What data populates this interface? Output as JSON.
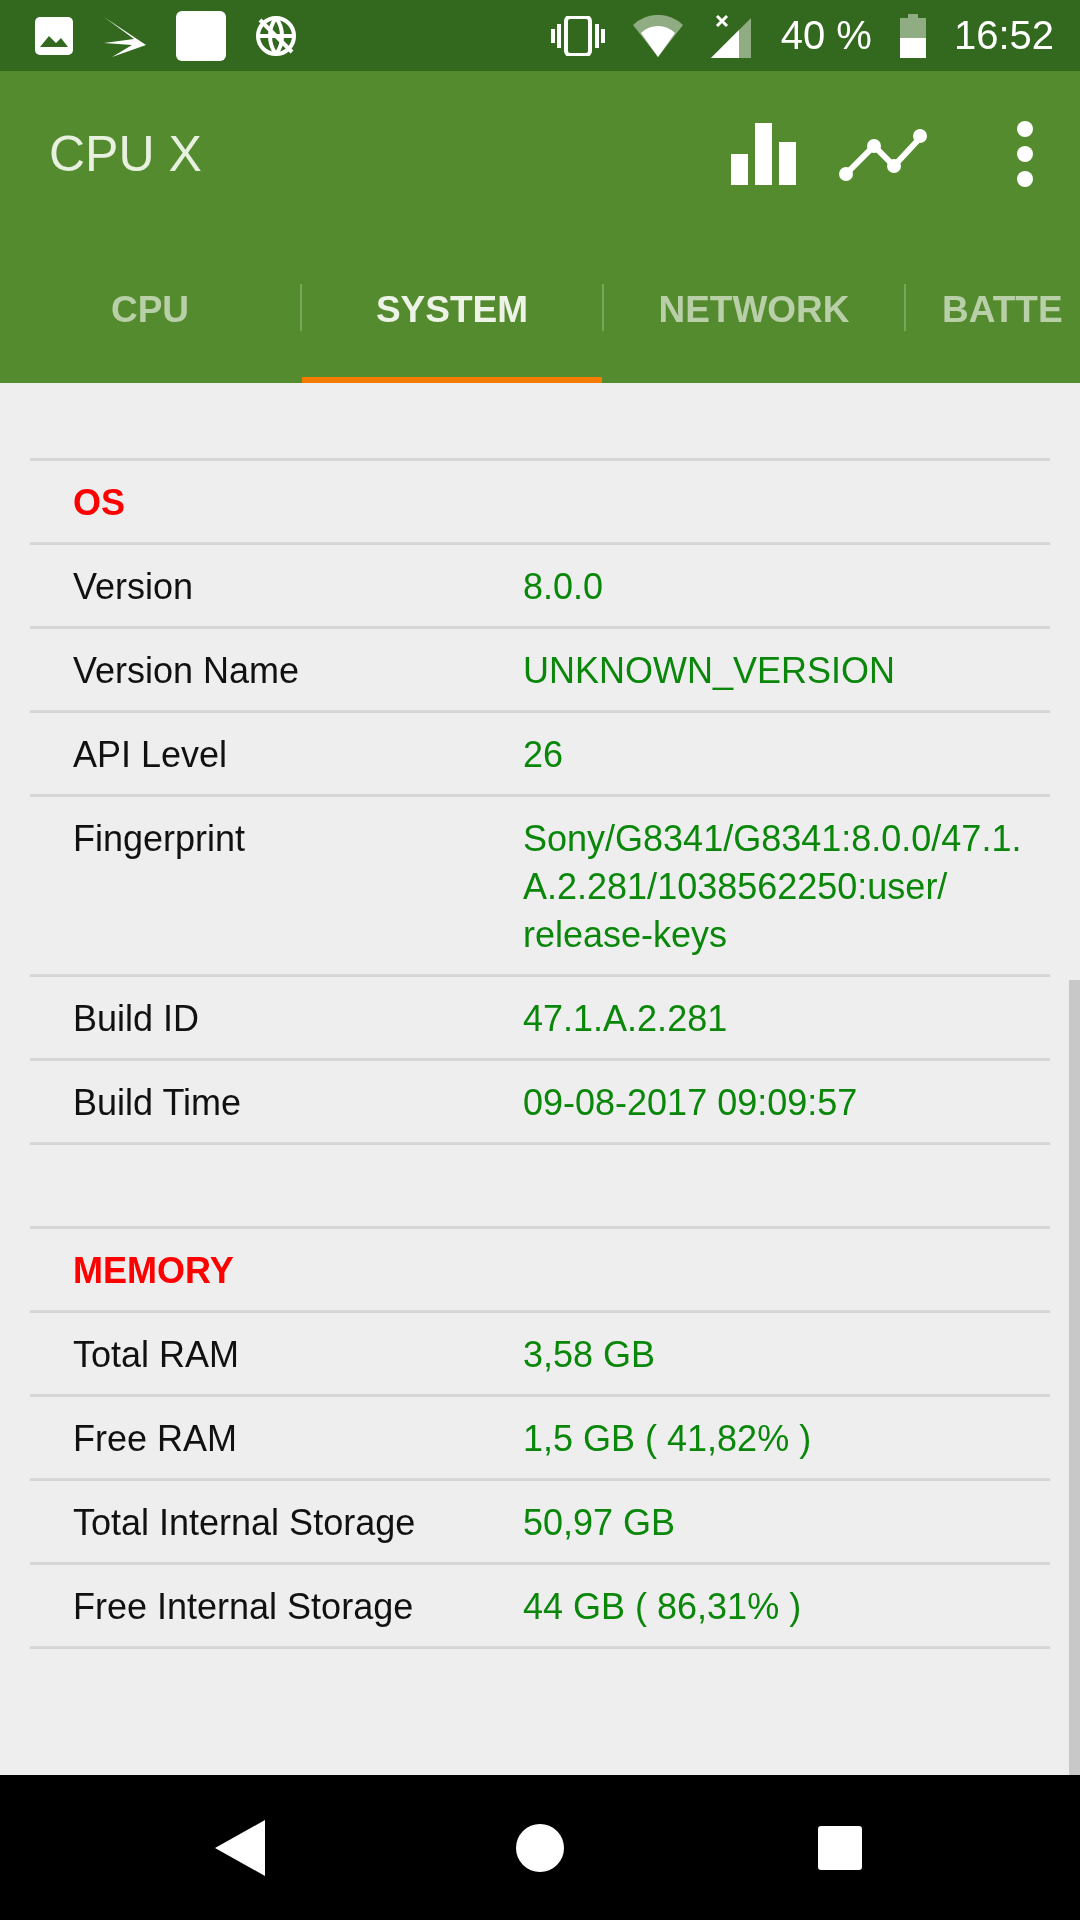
{
  "status_bar": {
    "battery": "40 %",
    "time": "16:52"
  },
  "app_bar": {
    "title": "CPU X"
  },
  "tabs": [
    {
      "label": "CPU",
      "selected": false
    },
    {
      "label": "SYSTEM",
      "selected": true
    },
    {
      "label": "NETWORK",
      "selected": false
    },
    {
      "label": "BATTE",
      "selected": false
    }
  ],
  "sections": [
    {
      "title": "OS",
      "rows": [
        {
          "label": "Version",
          "value": "8.0.0"
        },
        {
          "label": "Version Name",
          "value": "UNKNOWN_VERSION"
        },
        {
          "label": "API Level",
          "value": "26"
        },
        {
          "label": "Fingerprint",
          "value": "Sony/G8341/G8341:8.0.0/47.1.A.2.281/1038562250:user/release-keys"
        },
        {
          "label": "Build ID",
          "value": "47.1.A.2.281"
        },
        {
          "label": "Build Time",
          "value": "09-08-2017 09:09:57"
        }
      ]
    },
    {
      "title": "MEMORY",
      "rows": [
        {
          "label": "Total RAM",
          "value": "3,58 GB"
        },
        {
          "label": "Free RAM",
          "value": "1,5 GB ( 41,82% )"
        },
        {
          "label": "Total Internal Storage",
          "value": "50,97 GB"
        },
        {
          "label": "Free Internal Storage",
          "value": "44 GB ( 86,31% )"
        }
      ]
    }
  ]
}
